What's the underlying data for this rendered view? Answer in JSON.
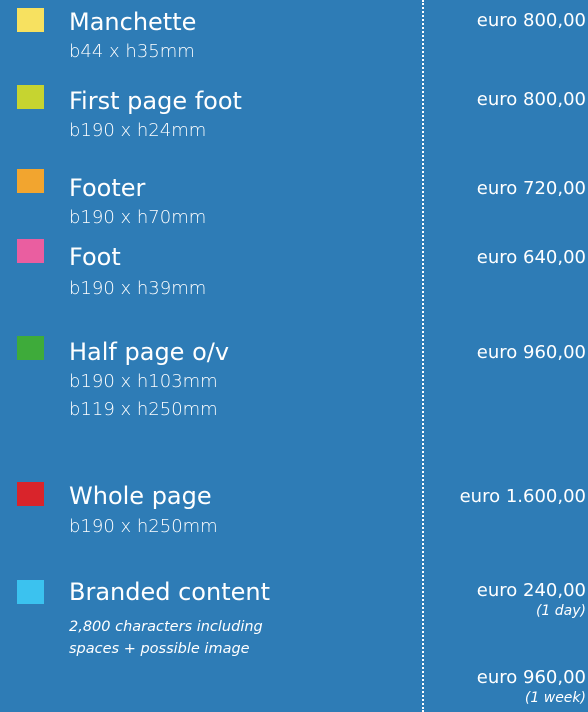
{
  "items": [
    {
      "title": "Manchette",
      "dims": [
        "b44 x h35mm"
      ],
      "price": "euro 800,00",
      "color": "#f7e160"
    },
    {
      "title": "First page foot",
      "dims": [
        "b190 x h24mm"
      ],
      "price": "euro 800,00",
      "color": "#c6d430"
    },
    {
      "title": "Footer",
      "dims": [
        "b190 x h70mm"
      ],
      "price": "euro 720,00",
      "color": "#f2a52f"
    },
    {
      "title": "Foot",
      "dims": [
        "b190 x h39mm"
      ],
      "price": "euro 640,00",
      "color": "#ea5ea0"
    },
    {
      "title": "Half page o/v",
      "dims": [
        "b190 x h103mm",
        "b119 x h250mm"
      ],
      "price": "euro 960,00",
      "color": "#3eab3a"
    },
    {
      "title": "Whole page",
      "dims": [
        "b190 x h250mm"
      ],
      "price": "euro 1.600,00",
      "color": "#d9242b"
    },
    {
      "title": "Branded content",
      "desc": [
        "2,800 characters including",
        "spaces + possible image"
      ],
      "prices": [
        {
          "price": "euro 240,00",
          "note": "(1 day)"
        },
        {
          "price": "euro 960,00",
          "note": "(1 week)"
        }
      ],
      "color": "#3bc2ef"
    }
  ]
}
